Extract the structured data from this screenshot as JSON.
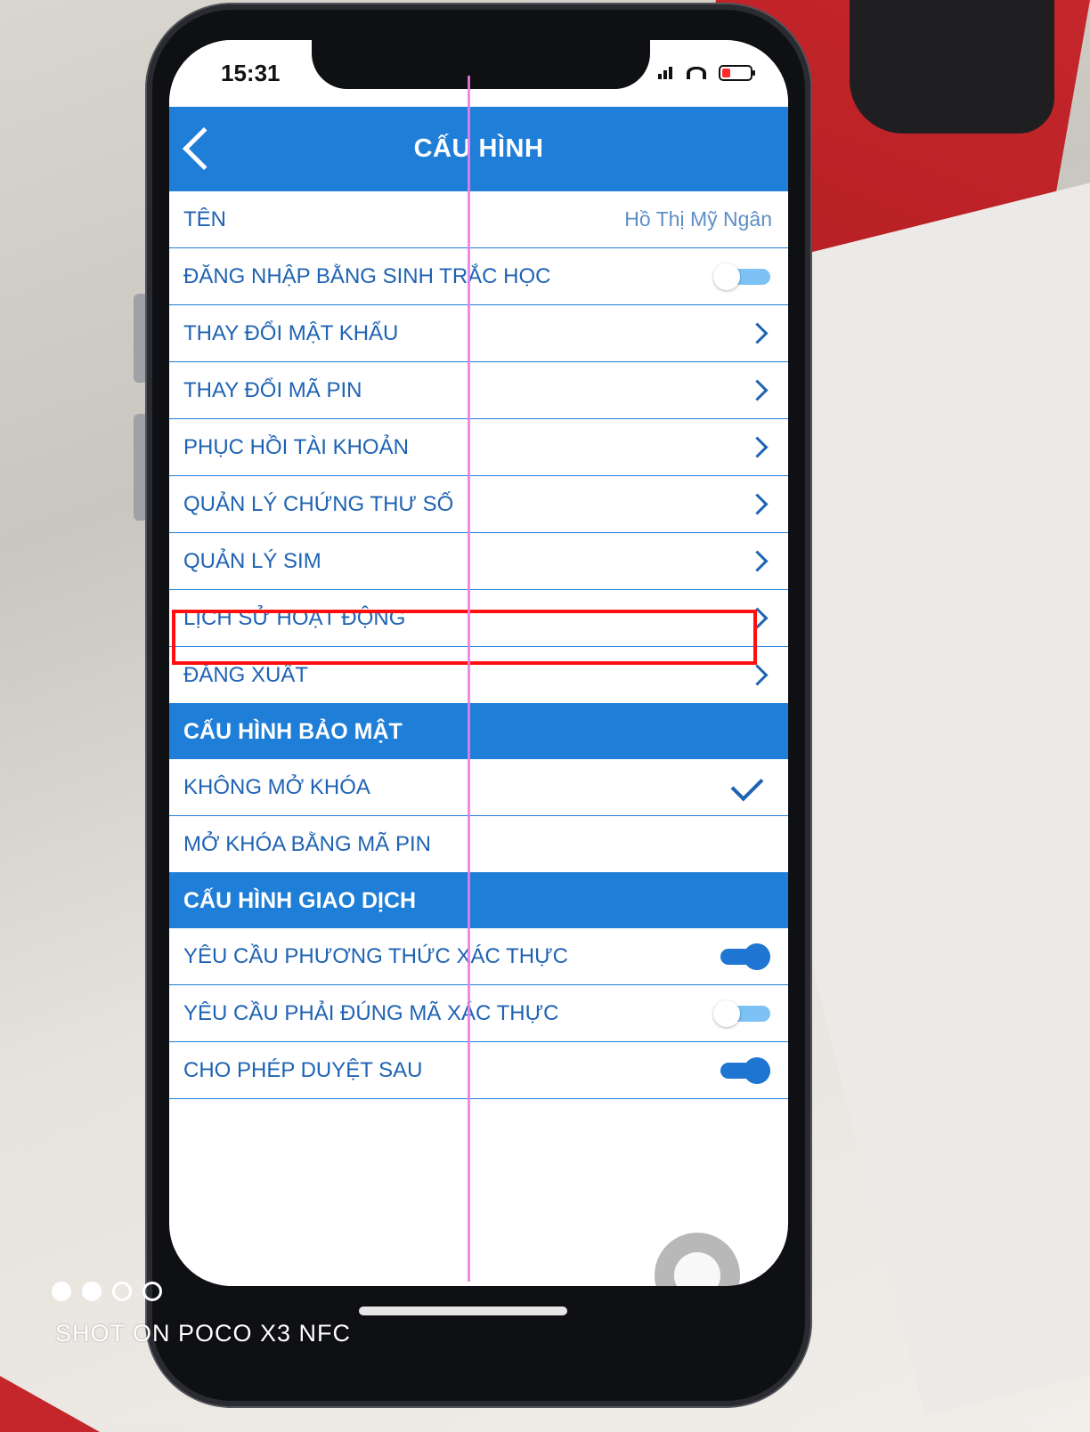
{
  "status_bar": {
    "time": "15:31"
  },
  "header": {
    "title": "CẤU HÌNH"
  },
  "rows": {
    "name_label": "TÊN",
    "name_value": "Hồ Thị Mỹ Ngân",
    "biometric_label": "ĐĂNG NHẬP BẰNG SINH TRẮC HỌC",
    "biometric_enabled": false,
    "change_password": "THAY ĐỔI MẬT KHẨU",
    "change_pin": "THAY ĐỔI MÃ PIN",
    "recover_account": "PHỤC HỒI TÀI KHOẢN",
    "manage_certificates": "QUẢN LÝ CHỨNG THƯ SỐ",
    "manage_sim": "QUẢN LÝ SIM",
    "activity_history": "LỊCH SỬ HOẠT ĐỘNG",
    "logout": "ĐĂNG XUẤT"
  },
  "security": {
    "section_title": "CẤU HÌNH BẢO MẬT",
    "no_unlock": "KHÔNG MỞ KHÓA",
    "no_unlock_selected": true,
    "pin_unlock": "MỞ KHÓA BẰNG MÃ PIN"
  },
  "transaction": {
    "section_title": "CẤU HÌNH GIAO DỊCH",
    "require_auth_method": "YÊU CẦU PHƯƠNG THỨC XÁC THỰC",
    "require_auth_method_enabled": true,
    "require_correct_code": "YÊU CẦU PHẢI ĐÚNG MÃ XÁC THỰC",
    "require_correct_code_enabled": false,
    "allow_later_approval": "CHO PHÉP DUYỆT SAU",
    "allow_later_approval_enabled": true
  },
  "camera_overlay": {
    "text": "SHOT ON POCO X3 NFC"
  },
  "colors": {
    "primary": "#1f7ed8",
    "text_blue": "#1f63b3",
    "highlight": "#ff1010"
  }
}
